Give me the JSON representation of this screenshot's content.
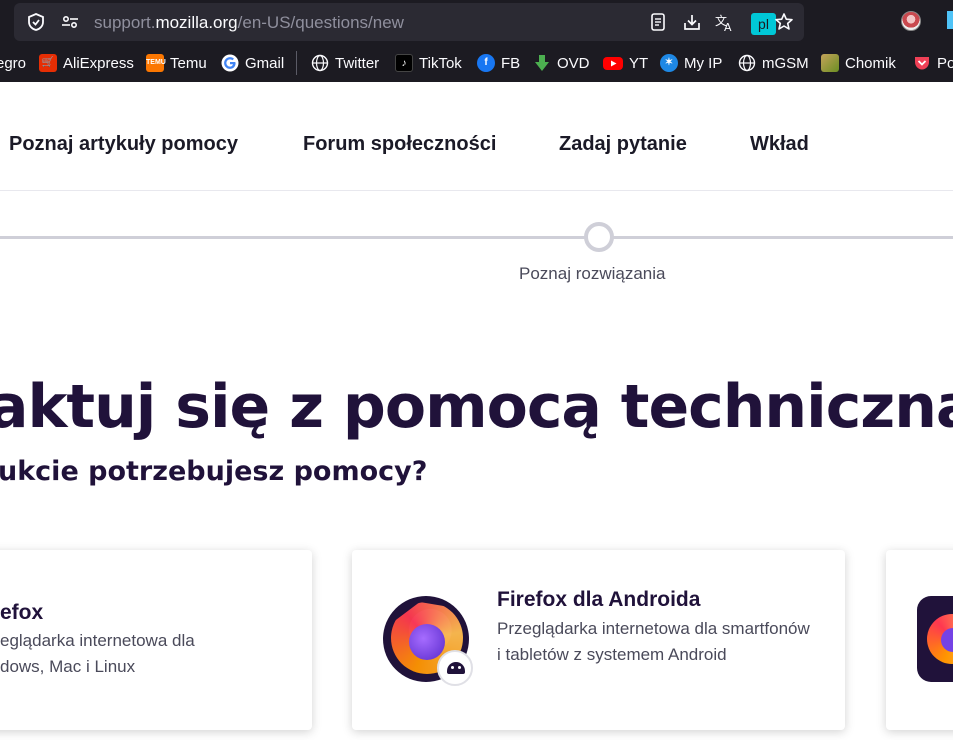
{
  "browser": {
    "url_prefix": "support.",
    "url_domain": "mozilla.org",
    "url_path": "/en-US/questions/new",
    "translate_badge": "pl",
    "bookmarks": [
      {
        "label": "egro",
        "icon": "allegro-icon",
        "color": "#ff5a00"
      },
      {
        "label": "AliExpress",
        "icon": "aliexpress-icon",
        "color": "#e62e04"
      },
      {
        "label": "Temu",
        "icon": "temu-icon",
        "color": "#fb7701"
      },
      {
        "label": "Gmail",
        "icon": "google-icon",
        "color": "#ffffff"
      },
      {
        "label": "Twitter",
        "icon": "globe-icon",
        "color": "#1c1b22"
      },
      {
        "label": "TikTok",
        "icon": "tiktok-icon",
        "color": "#000000"
      },
      {
        "label": "FB",
        "icon": "facebook-icon",
        "color": "#1877f2"
      },
      {
        "label": "OVD",
        "icon": "download-arrow-icon",
        "color": "#4caf50"
      },
      {
        "label": "YT",
        "icon": "youtube-icon",
        "color": "#ff0000"
      },
      {
        "label": "My IP",
        "icon": "myip-icon",
        "color": "#1e88e5"
      },
      {
        "label": "mGSM",
        "icon": "globe-icon",
        "color": "#1c1b22"
      },
      {
        "label": "Chomik",
        "icon": "chomik-icon",
        "color": "#8bc34a"
      },
      {
        "label": "Po",
        "icon": "pocket-icon",
        "color": "#ef4056"
      }
    ]
  },
  "nav": {
    "items": [
      "Poznaj artykuły pomocy",
      "Forum społeczności",
      "Zadaj pytanie",
      "Wkład"
    ]
  },
  "progress": {
    "step_label": "Poznaj rozwiązania"
  },
  "hero": {
    "title": "aktuj się z pomocą techniczną",
    "subtitle": "ukcie potrzebujesz pomocy?"
  },
  "cards": [
    {
      "title": "efox",
      "desc_line1": "eglądarka internetowa dla",
      "desc_line2": "dows, Mac i Linux"
    },
    {
      "title": "Firefox dla Androida",
      "desc": "Przeglądarka internetowa dla smartfonów i tabletów z systemem Android"
    }
  ],
  "colors": {
    "chrome_bg": "#1c1b22",
    "urlbar_bg": "#2b2a33",
    "heading": "#20123a",
    "accent_badge": "#00c8d7"
  }
}
